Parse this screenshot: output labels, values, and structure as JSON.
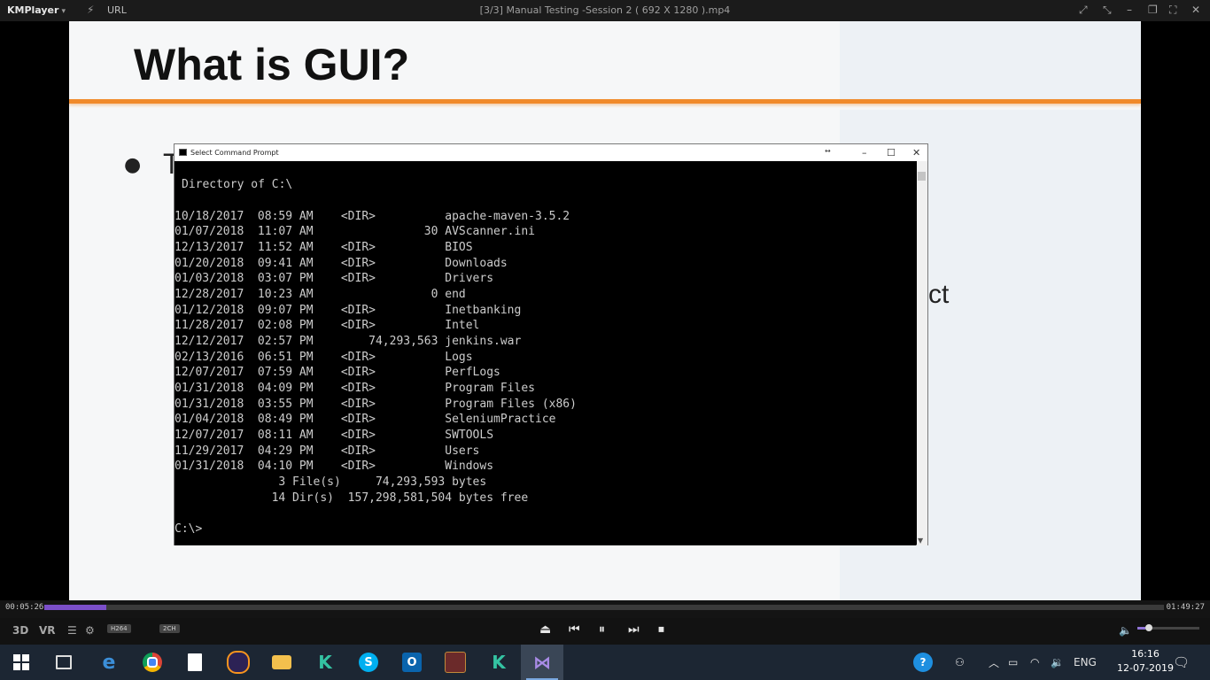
{
  "player": {
    "logo": "KMPlayer",
    "url_label": "URL",
    "title": "[3/3] Manual Testing -Session 2 ( 692 X 1280 ).mp4",
    "icons": [
      "pin-icon",
      "minimize-mode-icon",
      "minimize-icon",
      "restore-icon",
      "fullscreen-icon",
      "close-icon"
    ]
  },
  "slide": {
    "title": "What is GUI?",
    "bullet_text": "T",
    "partial_text": "ct",
    "accent_color": "#f08a2a"
  },
  "cmd": {
    "title": "Select Command Prompt",
    "lines": [
      "Directory of C:\\",
      "",
      "10/18/2017  08:59 AM    <DIR>          apache-maven-3.5.2",
      "01/07/2018  11:07 AM                30 AVScanner.ini",
      "12/13/2017  11:52 AM    <DIR>          BIOS",
      "01/20/2018  09:41 AM    <DIR>          Downloads",
      "01/03/2018  03:07 PM    <DIR>          Drivers",
      "12/28/2017  10:23 AM                 0 end",
      "01/12/2018  09:07 PM    <DIR>          Inetbanking",
      "11/28/2017  02:08 PM    <DIR>          Intel",
      "12/12/2017  02:57 PM        74,293,563 jenkins.war",
      "02/13/2016  06:51 PM    <DIR>          Logs",
      "12/07/2017  07:59 AM    <DIR>          PerfLogs",
      "01/31/2018  04:09 PM    <DIR>          Program Files",
      "01/31/2018  03:55 PM    <DIR>          Program Files (x86)",
      "01/04/2018  08:49 PM    <DIR>          SeleniumPractice",
      "12/07/2017  08:11 AM    <DIR>          SWTOOLS",
      "11/29/2017  04:29 PM    <DIR>          Users",
      "01/31/2018  04:10 PM    <DIR>          Windows",
      "               3 File(s)     74,293,593 bytes",
      "              14 Dir(s)  157,298,581,504 bytes free",
      "",
      "C:\\>"
    ]
  },
  "seek": {
    "elapsed": "00:05:26",
    "total": "01:49:27",
    "progress_fraction": 0.055
  },
  "controls": {
    "badge_codec": "H264",
    "badge_channels": "2CH",
    "label_3d": "3D",
    "label_vr": "VR",
    "volume_fraction": 0.13
  },
  "taskbar": {
    "apps": [
      "start-icon",
      "task-view-icon",
      "edge-icon",
      "chrome-icon",
      "notepad-icon",
      "eclipse-icon",
      "file-explorer-icon",
      "katalon-icon",
      "skype-icon",
      "outlook-icon",
      "game-icon",
      "katalon-studio-icon",
      "visual-studio-icon"
    ],
    "language": "ENG",
    "time": "16:16",
    "date": "12-07-2019"
  }
}
